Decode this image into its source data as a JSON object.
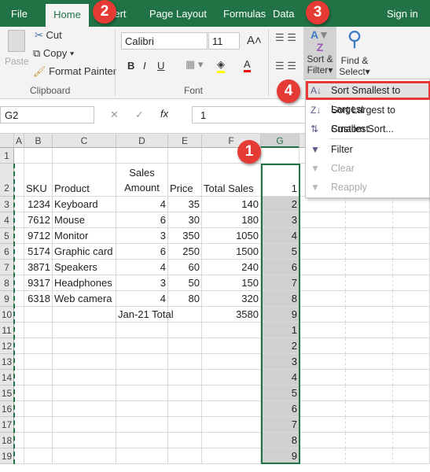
{
  "tabs": [
    "File",
    "Home",
    "Insert",
    "Page Layout",
    "Formulas",
    "Data",
    "Sign in"
  ],
  "clipboard": {
    "paste": "Paste",
    "cut": "Cut",
    "copy": "Copy",
    "format_painter": "Format Painter",
    "label": "Clipboard"
  },
  "font": {
    "name": "Calibri",
    "size": "11",
    "label": "Font",
    "bold": "B",
    "italic": "I",
    "underline": "U"
  },
  "editing": {
    "sort_filter_1": "Sort &",
    "sort_filter_2": "Filter",
    "find_select_1": "Find &",
    "find_select_2": "Select"
  },
  "formula_bar": {
    "name_box": "G2",
    "fx": "fx",
    "value": "1"
  },
  "columns": [
    "A",
    "B",
    "C",
    "D",
    "E",
    "F",
    "G"
  ],
  "rows": [
    [
      "",
      "",
      "",
      "",
      "",
      "",
      ""
    ],
    [
      "",
      "SKU",
      "Product",
      "Sales\nAmount",
      "Price",
      "Total Sales",
      "1"
    ],
    [
      "",
      "1234",
      "Keyboard",
      "4",
      "35",
      "140",
      "2"
    ],
    [
      "",
      "7612",
      "Mouse",
      "6",
      "30",
      "180",
      "3"
    ],
    [
      "",
      "9712",
      "Monitor",
      "3",
      "350",
      "1050",
      "4"
    ],
    [
      "",
      "5174",
      "Graphic card",
      "6",
      "250",
      "1500",
      "5"
    ],
    [
      "",
      "3871",
      "Speakers",
      "4",
      "60",
      "240",
      "6"
    ],
    [
      "",
      "9317",
      "Headphones",
      "3",
      "50",
      "150",
      "7"
    ],
    [
      "",
      "6318",
      "Web camera",
      "4",
      "80",
      "320",
      "8"
    ],
    [
      "",
      "",
      "",
      "Jan-21 Total",
      "",
      "3580",
      "9"
    ],
    [
      "",
      "",
      "",
      "",
      "",
      "",
      "1"
    ],
    [
      "",
      "",
      "",
      "",
      "",
      "",
      "2"
    ],
    [
      "",
      "",
      "",
      "",
      "",
      "",
      "3"
    ],
    [
      "",
      "",
      "",
      "",
      "",
      "",
      "4"
    ],
    [
      "",
      "",
      "",
      "",
      "",
      "",
      "5"
    ],
    [
      "",
      "",
      "",
      "",
      "",
      "",
      "6"
    ],
    [
      "",
      "",
      "",
      "",
      "",
      "",
      "7"
    ],
    [
      "",
      "",
      "",
      "",
      "",
      "",
      "8"
    ],
    [
      "",
      "",
      "",
      "",
      "",
      "",
      "9"
    ]
  ],
  "menu": [
    {
      "label": "Sort Smallest to Largest",
      "icon": "sort-ascending-icon",
      "enabled": true,
      "highlighted": true
    },
    {
      "label": "Sort Largest to Smallest",
      "icon": "sort-descending-icon",
      "enabled": true
    },
    {
      "label": "Custom Sort...",
      "icon": "custom-sort-icon",
      "enabled": true
    },
    {
      "label": "Filter",
      "icon": "filter-icon",
      "enabled": true
    },
    {
      "label": "Clear",
      "icon": "clear-filter-icon",
      "enabled": false
    },
    {
      "label": "Reapply",
      "icon": "reapply-icon",
      "enabled": false
    }
  ],
  "badges": [
    "1",
    "2",
    "3",
    "4"
  ],
  "colors": {
    "excel_green": "#217346",
    "badge_red": "#e63a35",
    "highlight_border": "#e63a35"
  }
}
